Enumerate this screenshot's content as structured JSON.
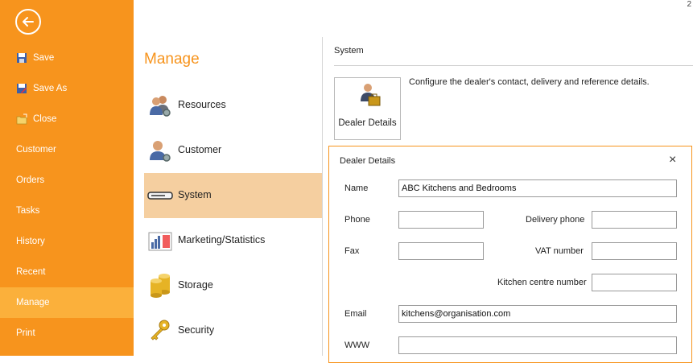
{
  "top_right_number": "2",
  "sidebar": {
    "items": [
      {
        "label": "Save",
        "icon": "save-icon"
      },
      {
        "label": "Save As",
        "icon": "save-as-icon"
      },
      {
        "label": "Close",
        "icon": "close-folder-icon"
      },
      {
        "label": "Customer"
      },
      {
        "label": "Orders"
      },
      {
        "label": "Tasks"
      },
      {
        "label": "History"
      },
      {
        "label": "Recent"
      },
      {
        "label": "Manage",
        "active": true
      },
      {
        "label": "Print"
      }
    ]
  },
  "middle": {
    "title": "Manage",
    "categories": [
      {
        "label": "Resources",
        "icon": "users-gear-icon"
      },
      {
        "label": "Customer",
        "icon": "customer-gear-icon"
      },
      {
        "label": "System",
        "icon": "system-device-icon",
        "active": true
      },
      {
        "label": "Marketing/Statistics",
        "icon": "statistics-chart-icon"
      },
      {
        "label": "Storage",
        "icon": "storage-cylinders-icon"
      },
      {
        "label": "Security",
        "icon": "keys-icon"
      }
    ]
  },
  "content": {
    "section_title": "System",
    "dealer_button_label": "Dealer Details",
    "description": "Configure the dealer's contact, delivery and reference details."
  },
  "dialog": {
    "title": "Dealer Details",
    "close": "×",
    "fields": {
      "name_label": "Name",
      "name_value": "ABC Kitchens and Bedrooms",
      "phone_label": "Phone",
      "phone_value": "",
      "delivery_phone_label": "Delivery phone",
      "delivery_phone_value": "",
      "fax_label": "Fax",
      "fax_value": "",
      "vat_label": "VAT number",
      "vat_value": "",
      "kitchen_centre_label": "Kitchen centre number",
      "kitchen_centre_value": "",
      "email_label": "Email",
      "email_value": "kitchens@organisation.com",
      "www_label": "WWW",
      "www_value": ""
    }
  },
  "colors": {
    "accent": "#f7941d",
    "active_side": "#fbb03b",
    "active_category": "#f5cfa0"
  }
}
